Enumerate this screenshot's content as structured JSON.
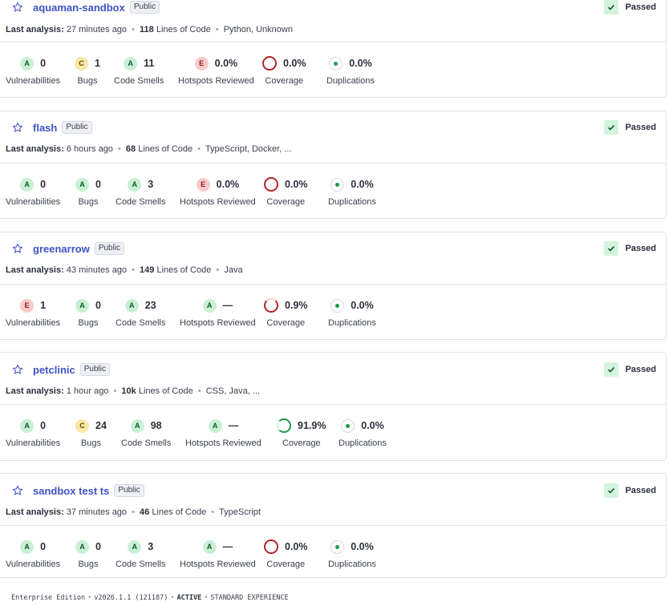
{
  "quality_gate_label": "Passed",
  "labels": {
    "last_analysis": "Last analysis:",
    "lines_of_code": "Lines of Code",
    "vulnerabilities": "Vulnerabilities",
    "bugs": "Bugs",
    "code_smells": "Code Smells",
    "hotspots": "Hotspots Reviewed",
    "coverage": "Coverage",
    "duplications": "Duplications"
  },
  "projects": [
    {
      "name": "aquaman-sandbox",
      "visibility": "Public",
      "analyzed": "27 minutes ago",
      "loc": "118",
      "langs": "Python, Unknown",
      "vuln_rating": "A",
      "vuln": "0",
      "bugs_rating": "C",
      "bugs": "1",
      "smells_rating": "A",
      "smells": "11",
      "hotspots_rating": "E",
      "hotspots": "0.0%",
      "coverage": "0.0%",
      "duplications": "0.0%"
    },
    {
      "name": "flash",
      "visibility": "Public",
      "analyzed": "6 hours ago",
      "loc": "68",
      "langs": "TypeScript, Docker, ...",
      "vuln_rating": "A",
      "vuln": "0",
      "bugs_rating": "A",
      "bugs": "0",
      "smells_rating": "A",
      "smells": "3",
      "hotspots_rating": "E",
      "hotspots": "0.0%",
      "coverage": "0.0%",
      "duplications": "0.0%"
    },
    {
      "name": "greenarrow",
      "visibility": "Public",
      "analyzed": "43 minutes ago",
      "loc": "149",
      "langs": "Java",
      "vuln_rating": "E",
      "vuln": "1",
      "bugs_rating": "A",
      "bugs": "0",
      "smells_rating": "A",
      "smells": "23",
      "hotspots_rating": "A",
      "hotspots": "—",
      "coverage": "0.9%",
      "duplications": "0.0%"
    },
    {
      "name": "petclinic",
      "visibility": "Public",
      "analyzed": "1 hour ago",
      "loc": "10k",
      "langs": "CSS, Java, ...",
      "vuln_rating": "A",
      "vuln": "0",
      "bugs_rating": "C",
      "bugs": "24",
      "smells_rating": "A",
      "smells": "98",
      "hotspots_rating": "A",
      "hotspots": "—",
      "coverage": "91.9%",
      "duplications": "0.0%"
    },
    {
      "name": "sandbox test ts",
      "visibility": "Public",
      "analyzed": "37 minutes ago",
      "loc": "46",
      "langs": "TypeScript",
      "vuln_rating": "A",
      "vuln": "0",
      "bugs_rating": "A",
      "bugs": "0",
      "smells_rating": "A",
      "smells": "3",
      "hotspots_rating": "A",
      "hotspots": "—",
      "coverage": "0.0%",
      "duplications": "0.0%"
    }
  ],
  "footer": {
    "edition": "Enterprise Edition",
    "version": "v2026.1.1 (121187)",
    "status": "ACTIVE",
    "experience": "STANDARD EXPERIENCE"
  }
}
